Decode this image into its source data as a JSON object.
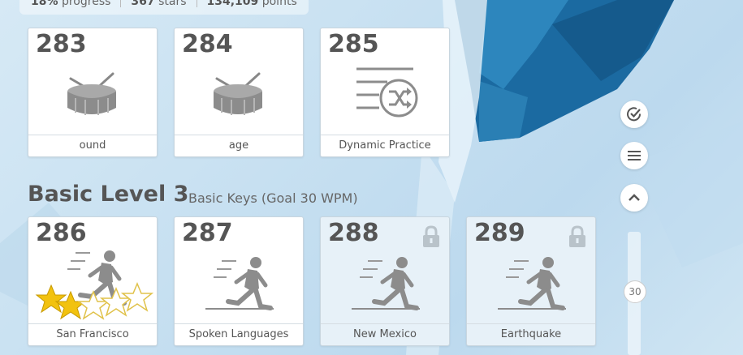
{
  "stats": {
    "progress_value": "18%",
    "progress_label": "progress",
    "stars_value": "367",
    "stars_label": "stars",
    "points_value": "134,109",
    "points_label": "points"
  },
  "lessons_top": [
    {
      "number": "283",
      "label": "ound",
      "icon": "drum-icon",
      "locked": false
    },
    {
      "number": "284",
      "label": "age",
      "icon": "drum-icon",
      "locked": false
    },
    {
      "number": "285",
      "label": "Dynamic Practice",
      "icon": "shuffle-practice-icon",
      "locked": false
    }
  ],
  "section": {
    "title": "Basic Level 3",
    "subtitle": "Basic Keys (Goal 30 WPM)"
  },
  "lessons_bottom": [
    {
      "number": "286",
      "label": "San Francisco",
      "icon": "runner-icon",
      "locked": false,
      "stars": 2,
      "stars_total": 5
    },
    {
      "number": "287",
      "label": "Spoken Languages",
      "icon": "runner-icon",
      "locked": false
    },
    {
      "number": "288",
      "label": "New Mexico",
      "icon": "runner-icon",
      "locked": true
    },
    {
      "number": "289",
      "label": "Earthquake",
      "icon": "runner-icon",
      "locked": true
    }
  ],
  "sidebar": {
    "check_icon": "check-circle-icon",
    "menu_icon": "menu-icon",
    "up_icon": "chevron-up-icon",
    "scroll_value": "30"
  },
  "colors": {
    "accent_blue": "#1d6fa5",
    "star_gold": "#f2c20f",
    "icon_gray": "#8c8c8c"
  }
}
